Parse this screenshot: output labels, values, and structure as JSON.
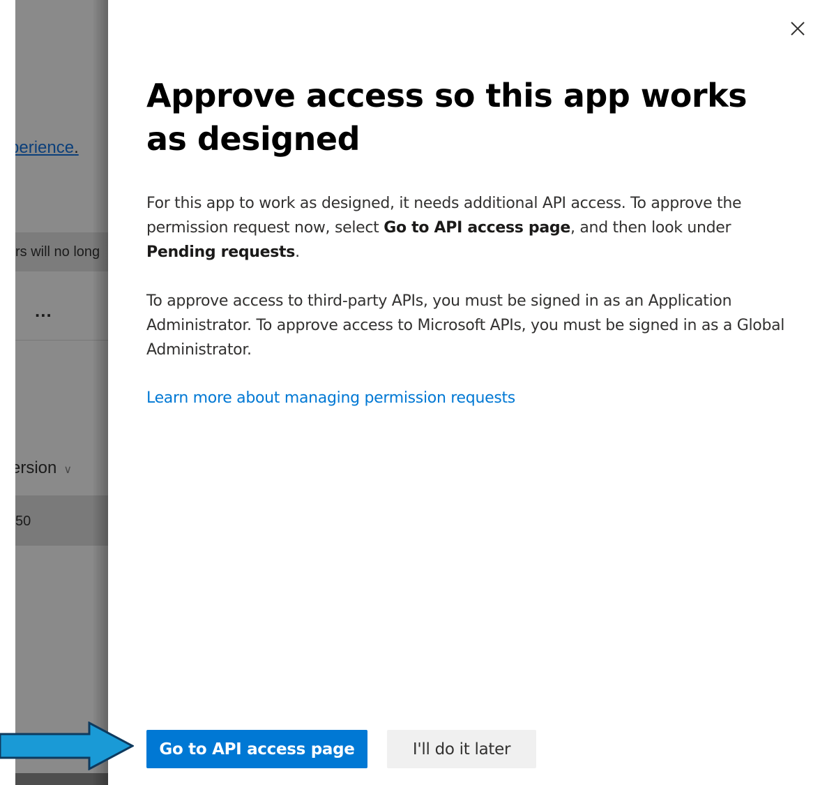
{
  "background_page": {
    "link_text": "perience",
    "link_suffix": ".",
    "banner_text": "rs will no long",
    "more_label": "...",
    "column_header": "ersion",
    "cell_value": "50"
  },
  "dialog": {
    "title": "Approve access so this app works as designed",
    "para1": {
      "part1": "For this app to work as designed, it needs additional API access. To approve the permission request now, select ",
      "bold1": "Go to API access page",
      "part2": ", and then look under ",
      "bold2": "Pending requests",
      "part3": "."
    },
    "para2": "To approve access to third-party APIs, you must be signed in as an Application Administrator. To approve access to Microsoft APIs, you must be signed in as a Global Administrator.",
    "learn_more_link": "Learn more about managing permission requests",
    "primary_button": "Go to API access page",
    "secondary_button": "I'll do it later",
    "close_icon": "close-icon"
  },
  "annotation": {
    "arrow_icon": "arrow-right-icon",
    "arrow_color": "#1a9ad6"
  },
  "colors": {
    "accent": "#0078d4",
    "title": "#000000",
    "body_text": "#323130",
    "secondary_button_bg": "#f0f0f0"
  }
}
